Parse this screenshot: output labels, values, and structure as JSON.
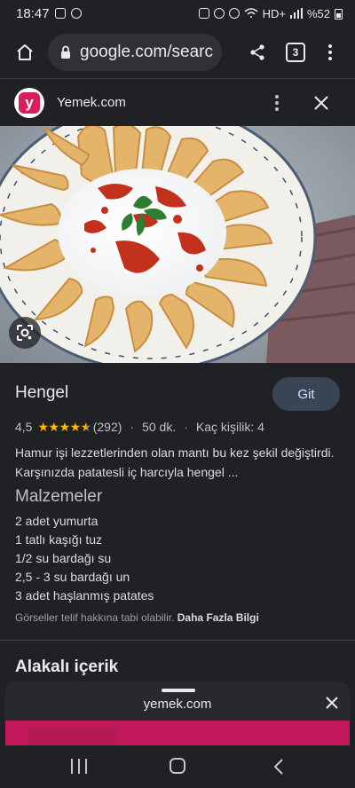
{
  "status_bar": {
    "time": "18:47",
    "network": "HD+",
    "battery": "%52"
  },
  "browser": {
    "url": "google.com/searc",
    "tab_count": "3"
  },
  "panel": {
    "site_name": "Yemek.com",
    "logo_letter": "y"
  },
  "recipe": {
    "title": "Hengel",
    "go_label": "Git",
    "rating": "4,5",
    "rating_value": 4.5,
    "reviews": "(292)",
    "duration": "50 dk.",
    "servings": "Kaç kişilik: 4",
    "description": "Hamur işi lezzetlerinden olan mantı bu kez şekil değiştirdi. Karşınızda patatesli iç harcıyla hengel ...",
    "ingredients_heading": "Malzemeler",
    "ingredients": [
      "2 adet yumurta",
      "1 tatlı kaşığı tuz",
      "1/2 su bardağı su",
      "2,5 - 3 su bardağı un",
      "3 adet haşlanmış patates"
    ],
    "copyright_text": "Görseller telif hakkına tabi olabilir.",
    "more_info": "Daha Fazla Bilgi"
  },
  "related": {
    "heading": "Alakalı içerik"
  },
  "sheet": {
    "title": "yemek.com"
  },
  "colors": {
    "background": "#202124",
    "star": "#fbbc04",
    "go_button": "#394457",
    "brand": "#d81e5b"
  },
  "icons": {
    "home": "home-icon",
    "lock": "lock-icon",
    "share": "share-icon",
    "more": "more-vert-icon",
    "close": "close-icon",
    "lens": "lens-icon"
  }
}
